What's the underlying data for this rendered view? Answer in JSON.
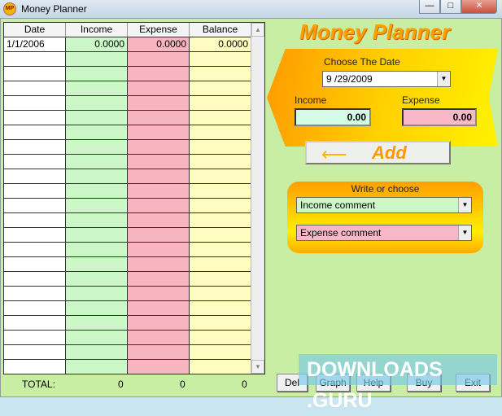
{
  "window": {
    "title": "Money Planner",
    "icon_text": "MP"
  },
  "grid": {
    "columns": [
      "Date",
      "Income",
      "Expense",
      "Balance"
    ],
    "rows": [
      [
        "1/1/2006",
        "0.0000",
        "0.0000",
        "0.0000"
      ]
    ],
    "empty_rows": 22
  },
  "totals": {
    "label": "TOTAL:",
    "income": "0",
    "expense": "0",
    "balance": "0"
  },
  "brand": "Money Planner",
  "date": {
    "label": "Choose The Date",
    "value": "9 /29/2009"
  },
  "income": {
    "label": "Income",
    "value": "0.00"
  },
  "expense": {
    "label": "Expense",
    "value": "0.00"
  },
  "add_label": "Add",
  "comments": {
    "label": "Write or choose",
    "income": "Income comment",
    "expense": "Expense comment"
  },
  "buttons": {
    "del": "Del",
    "graph": "Graph",
    "help": "Help",
    "buy": "Buy",
    "exit": "Exit"
  },
  "watermark": "DOWNLOADS .GURU"
}
